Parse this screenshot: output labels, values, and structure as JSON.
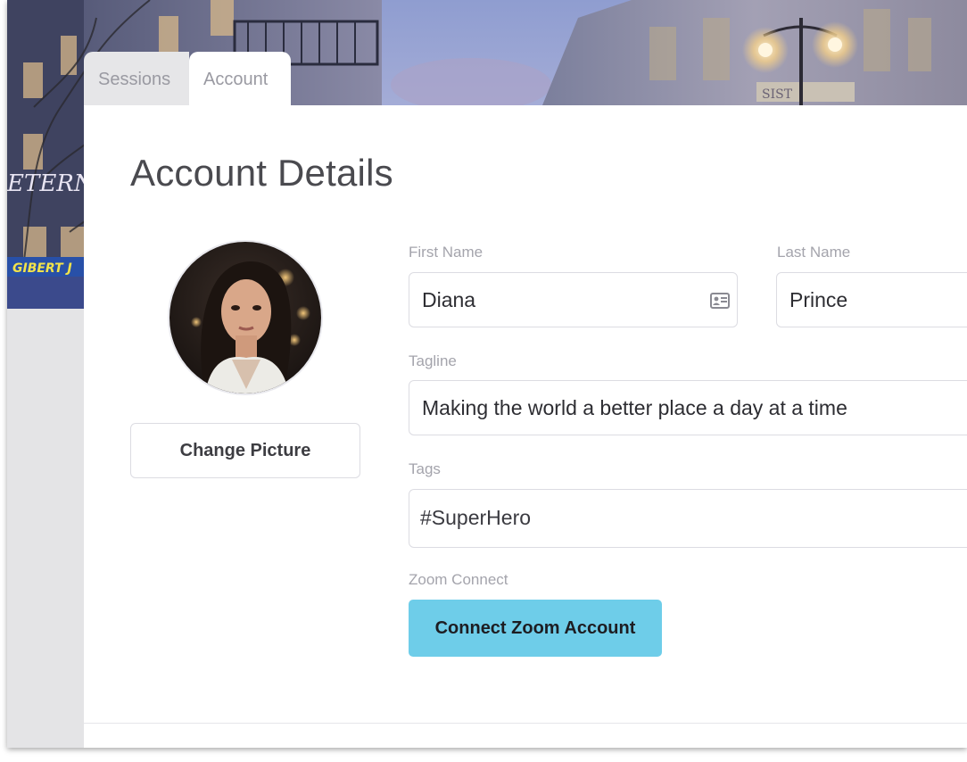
{
  "tabs": [
    {
      "label": "Sessions",
      "active": false
    },
    {
      "label": "Account",
      "active": true
    }
  ],
  "account": {
    "title": "Account Details",
    "change_picture_label": "Change Picture",
    "first_name_label": "First Name",
    "first_name_value": "Diana",
    "last_name_label": "Last Name",
    "last_name_value": "Prince",
    "tagline_label": "Tagline",
    "tagline_value": "Making the world a better place a day at a time",
    "tags_label": "Tags",
    "tags_value": "#SuperHero",
    "zoom_label": "Zoom Connect",
    "zoom_button_label": "Connect Zoom Account"
  },
  "hero": {
    "sign_text_1": "ETERN",
    "sign_text_2": "GIBERT J",
    "sign_text_3": "SIST"
  },
  "colors": {
    "accent_button": "#6ecde9",
    "page_gray": "#e4e4e6",
    "card_white": "#ffffff"
  },
  "icons": {
    "first_name_field": "contact-card-icon"
  }
}
